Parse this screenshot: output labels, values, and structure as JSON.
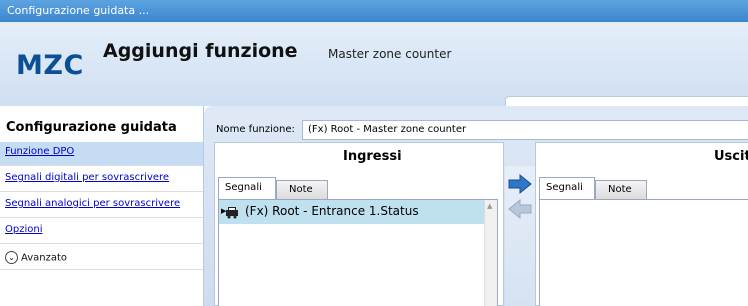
{
  "window": {
    "title": "Configurazione guidata ..."
  },
  "header": {
    "logo": "MZC",
    "title": "Aggiungi funzione",
    "subtitle": "Master zone counter",
    "tab": "Funzione DPO"
  },
  "sidebar": {
    "title": "Configurazione guidata",
    "items": [
      {
        "label": "Funzione DPO"
      },
      {
        "label": "Segnali digitali per sovrascrivere"
      },
      {
        "label": "Segnali analogici per sovrascrivere"
      },
      {
        "label": "Opzioni"
      }
    ],
    "advanced": {
      "label": "Avanzato",
      "icon": "chevron-down-circle-icon"
    }
  },
  "form": {
    "name_label": "Nome funzione:",
    "name_value": "(Fx) Root - Master zone counter"
  },
  "inputs_panel": {
    "title": "Ingressi",
    "tabs": [
      {
        "label": "Segnali"
      },
      {
        "label": "Note"
      }
    ],
    "rows": [
      {
        "label": "(Fx) Root - Entrance 1.Status",
        "icon": "car-icon"
      }
    ]
  },
  "outputs_panel": {
    "title": "Uscite",
    "tabs": [
      {
        "label": "Segnali"
      },
      {
        "label": "Note"
      }
    ]
  },
  "colors": {
    "titlebar": "#3d86cf",
    "logo": "#0b4f95",
    "selected_row": "#bfe0ef",
    "link": "#0000cc"
  }
}
